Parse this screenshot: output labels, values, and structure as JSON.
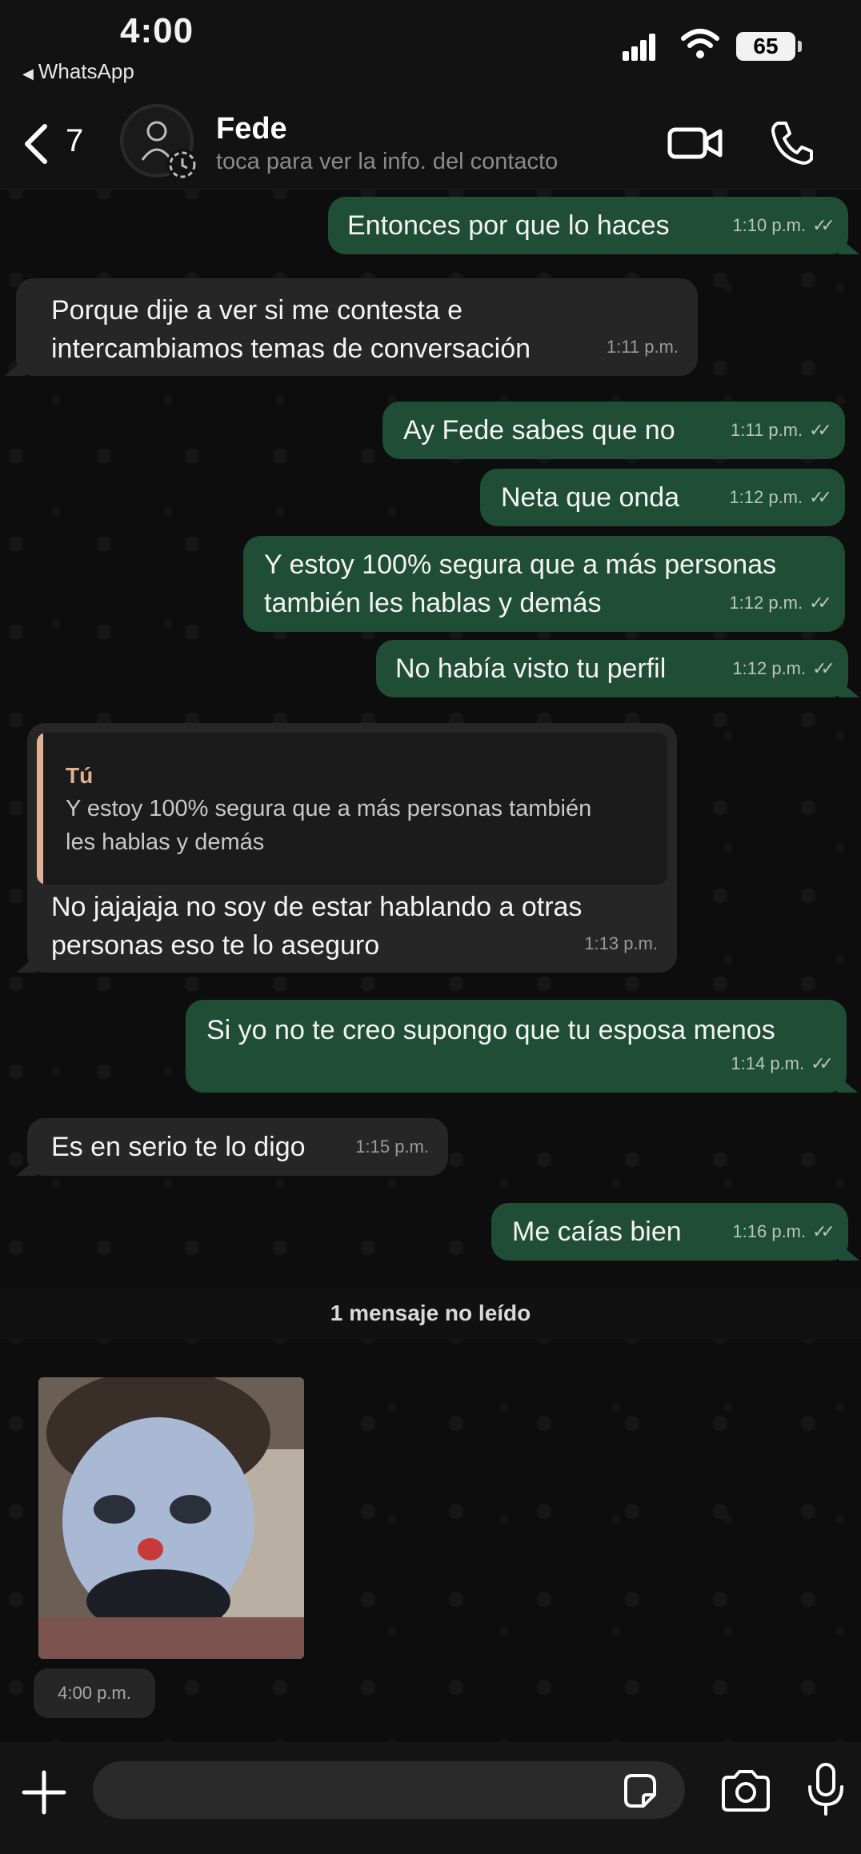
{
  "status_bar": {
    "time": "4:00",
    "back_app": "WhatsApp",
    "battery": "65"
  },
  "header": {
    "unread_count": "7",
    "contact_name": "Fede",
    "contact_subtitle": "toca para ver la info. del contacto",
    "video_icon": "video-camera-icon",
    "call_icon": "phone-icon"
  },
  "messages": [
    {
      "direction": "out",
      "text": "Entonces por que lo haces",
      "time": "1:10 p.m."
    },
    {
      "direction": "in",
      "text_lines": [
        "Porque dije a ver si me contesta e",
        "intercambiamos temas de conversación"
      ],
      "time": "1:11 p.m."
    },
    {
      "direction": "out",
      "text": "Ay Fede sabes que no",
      "time": "1:11 p.m."
    },
    {
      "direction": "out",
      "text": "Neta que onda",
      "time": "1:12 p.m."
    },
    {
      "direction": "out",
      "text_lines": [
        "Y estoy 100% segura que a más personas",
        "también les hablas y demás"
      ],
      "time": "1:12 p.m."
    },
    {
      "direction": "out",
      "text": "No había visto tu perfil",
      "time": "1:12 p.m."
    },
    {
      "direction": "in",
      "quote": {
        "author": "Tú",
        "text_lines": [
          "Y estoy 100% segura que a más personas también",
          "les hablas y demás"
        ]
      },
      "text_lines": [
        "No jajajaja no soy de estar hablando a otras",
        "personas eso te lo aseguro"
      ],
      "time": "1:13 p.m."
    },
    {
      "direction": "out",
      "text": "Si yo no te creo supongo que tu esposa menos",
      "time": "1:14 p.m."
    },
    {
      "direction": "in",
      "text": "Es en serio te lo digo",
      "time": "1:15 p.m."
    },
    {
      "direction": "out",
      "text": "Me caías bien",
      "time": "1:16 p.m."
    }
  ],
  "unread_banner": "1 mensaje no leído",
  "photo_message": {
    "time": "4:00 p.m."
  },
  "input_bar": {
    "placeholder": "",
    "icons": [
      "plus-icon",
      "sticker-icon",
      "camera-icon",
      "microphone-icon"
    ]
  },
  "colors": {
    "outgoing_bubble": "#1f4d35",
    "incoming_bubble": "#262626",
    "quote_accent": "#e0b192",
    "background": "#0d0d0d"
  }
}
